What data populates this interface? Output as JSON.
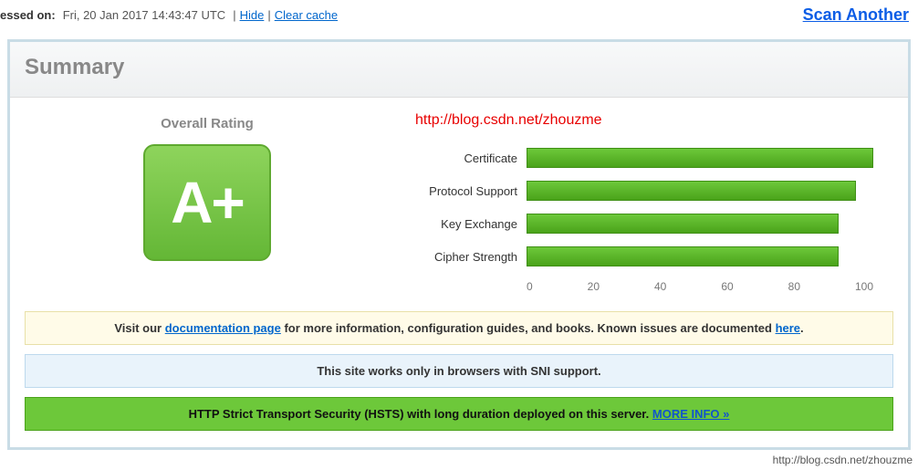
{
  "top": {
    "label_prefix": "essed on:",
    "date": "Fri, 20 Jan 2017 14:43:47 UTC",
    "sep": "|",
    "hide": "Hide",
    "clear": "Clear cache"
  },
  "scan_another": "Scan Another",
  "panel": {
    "title": "Summary"
  },
  "rating": {
    "label": "Overall Rating",
    "grade": "A+"
  },
  "watermark": "http://blog.csdn.net/zhouzme",
  "chart_data": {
    "type": "bar",
    "categories": [
      "Certificate",
      "Protocol Support",
      "Key Exchange",
      "Cipher Strength"
    ],
    "values": [
      100,
      95,
      90,
      90
    ],
    "xlabel": "",
    "ylabel": "",
    "ylim": [
      0,
      100
    ],
    "ticks": [
      "0",
      "20",
      "40",
      "60",
      "80",
      "100"
    ]
  },
  "banners": {
    "yellow_pre": "Visit our ",
    "yellow_link1": "documentation page",
    "yellow_mid": " for more information, configuration guides, and books. Known issues are documented ",
    "yellow_link2": "here",
    "yellow_post": ".",
    "blue": "This site works only in browsers with SNI support.",
    "green_text": "HTTP Strict Transport Security (HSTS) with long duration deployed on this server.  ",
    "green_link": "MORE INFO »"
  },
  "footer_wm": "http://blog.csdn.net/zhouzme"
}
